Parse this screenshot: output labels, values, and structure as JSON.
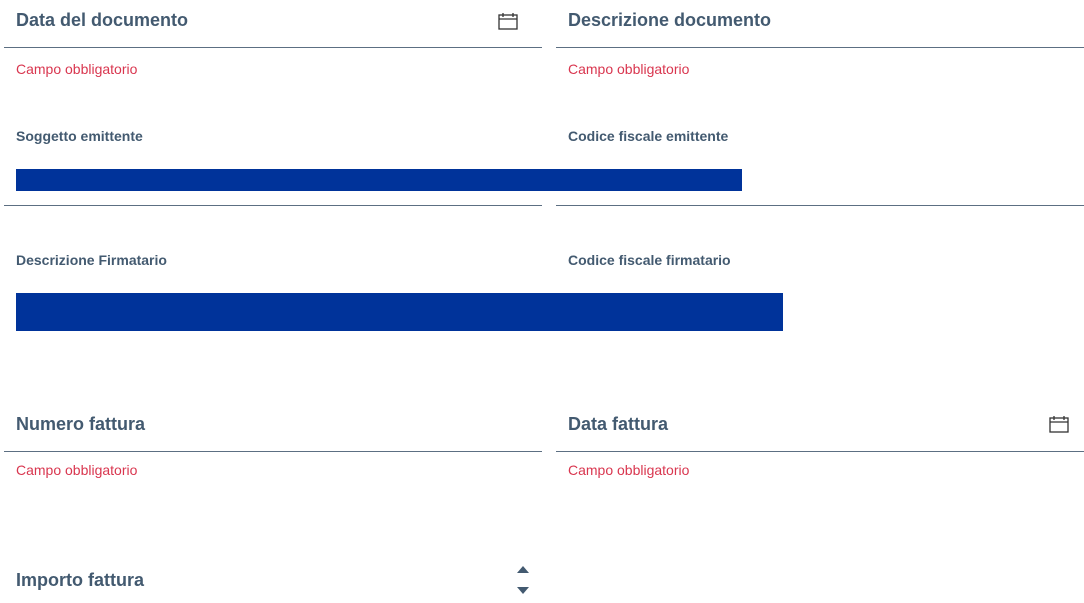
{
  "form": {
    "data_documento": {
      "label": "Data del documento",
      "error": "Campo obbligatorio"
    },
    "descrizione_documento": {
      "label": "Descrizione documento",
      "error": "Campo obbligatorio"
    },
    "soggetto_emittente": {
      "label": "Soggetto emittente"
    },
    "codice_fiscale_emittente": {
      "label": "Codice fiscale emittente"
    },
    "descrizione_firmatario": {
      "label": "Descrizione Firmatario"
    },
    "codice_fiscale_firmatario": {
      "label": "Codice fiscale firmatario"
    },
    "numero_fattura": {
      "label": "Numero fattura",
      "error": "Campo obbligatorio"
    },
    "data_fattura": {
      "label": "Data fattura",
      "error": "Campo obbligatorio"
    },
    "importo_fattura": {
      "label": "Importo fattura"
    }
  },
  "icons": {
    "calendar": "calendar-icon",
    "spinner_up": "caret-up-icon",
    "spinner_down": "caret-down-icon"
  },
  "colors": {
    "label": "#435a70",
    "error": "#d9364f",
    "underline": "#5c6f82",
    "redaction": "#00339a"
  }
}
